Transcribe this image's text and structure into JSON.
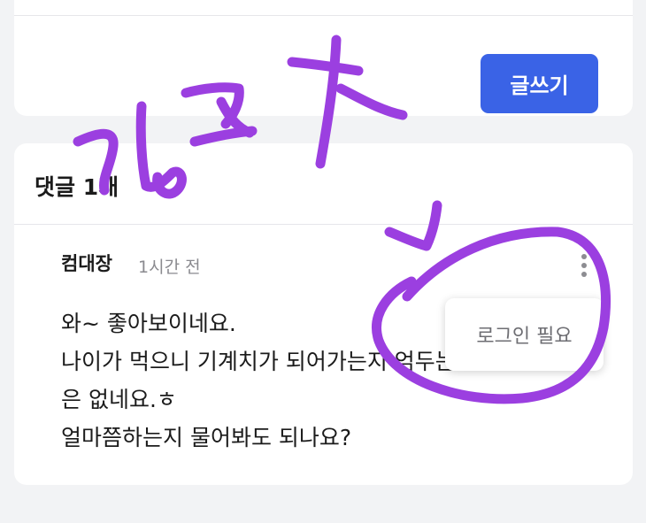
{
  "toolbar": {
    "write_label": "글쓰기"
  },
  "comments": {
    "title": "댓글 1개",
    "items": [
      {
        "author": "컴대장",
        "time": "1시간 전",
        "body": "와~ 좋아보이네요.\n나이가 먹으니 기계치가 되어가는지 엄두는 엄\n은 없네요.ㅎ\n얼마쯤하는지 물어봐도 되나요?"
      }
    ]
  },
  "menu": {
    "login_required": "로그인 필요"
  },
  "annotation": {
    "handwritten_text": "링크",
    "stroke_color": "#9b3fe0"
  },
  "colors": {
    "accent": "#3a63e6",
    "background": "#f2f3f5"
  }
}
